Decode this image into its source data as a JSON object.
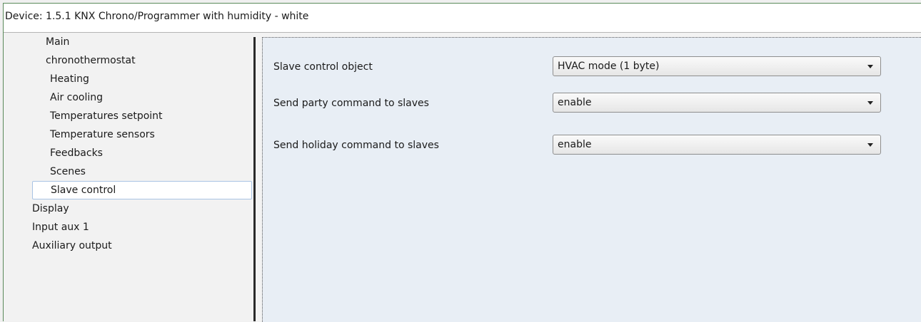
{
  "window": {
    "title": "Device: 1.5.1  KNX Chrono/Programmer with humidity - white"
  },
  "sidebar": {
    "items": [
      {
        "label": "Main"
      },
      {
        "label": "chronothermostat"
      },
      {
        "label": "Heating"
      },
      {
        "label": "Air cooling"
      },
      {
        "label": "Temperatures setpoint"
      },
      {
        "label": "Temperature sensors"
      },
      {
        "label": "Feedbacks"
      },
      {
        "label": "Scenes"
      },
      {
        "label": "Slave control"
      },
      {
        "label": "Display"
      },
      {
        "label": "Input aux 1"
      },
      {
        "label": "Auxiliary output"
      }
    ],
    "selected": "Slave control"
  },
  "params": [
    {
      "label": "Slave control object",
      "value": "HVAC mode (1 byte)"
    },
    {
      "label": "Send party command to slaves",
      "value": "enable"
    },
    {
      "label": "Send holiday command to slaves",
      "value": "enable"
    }
  ],
  "icons": {
    "dropdown": "chevron-down-icon"
  }
}
